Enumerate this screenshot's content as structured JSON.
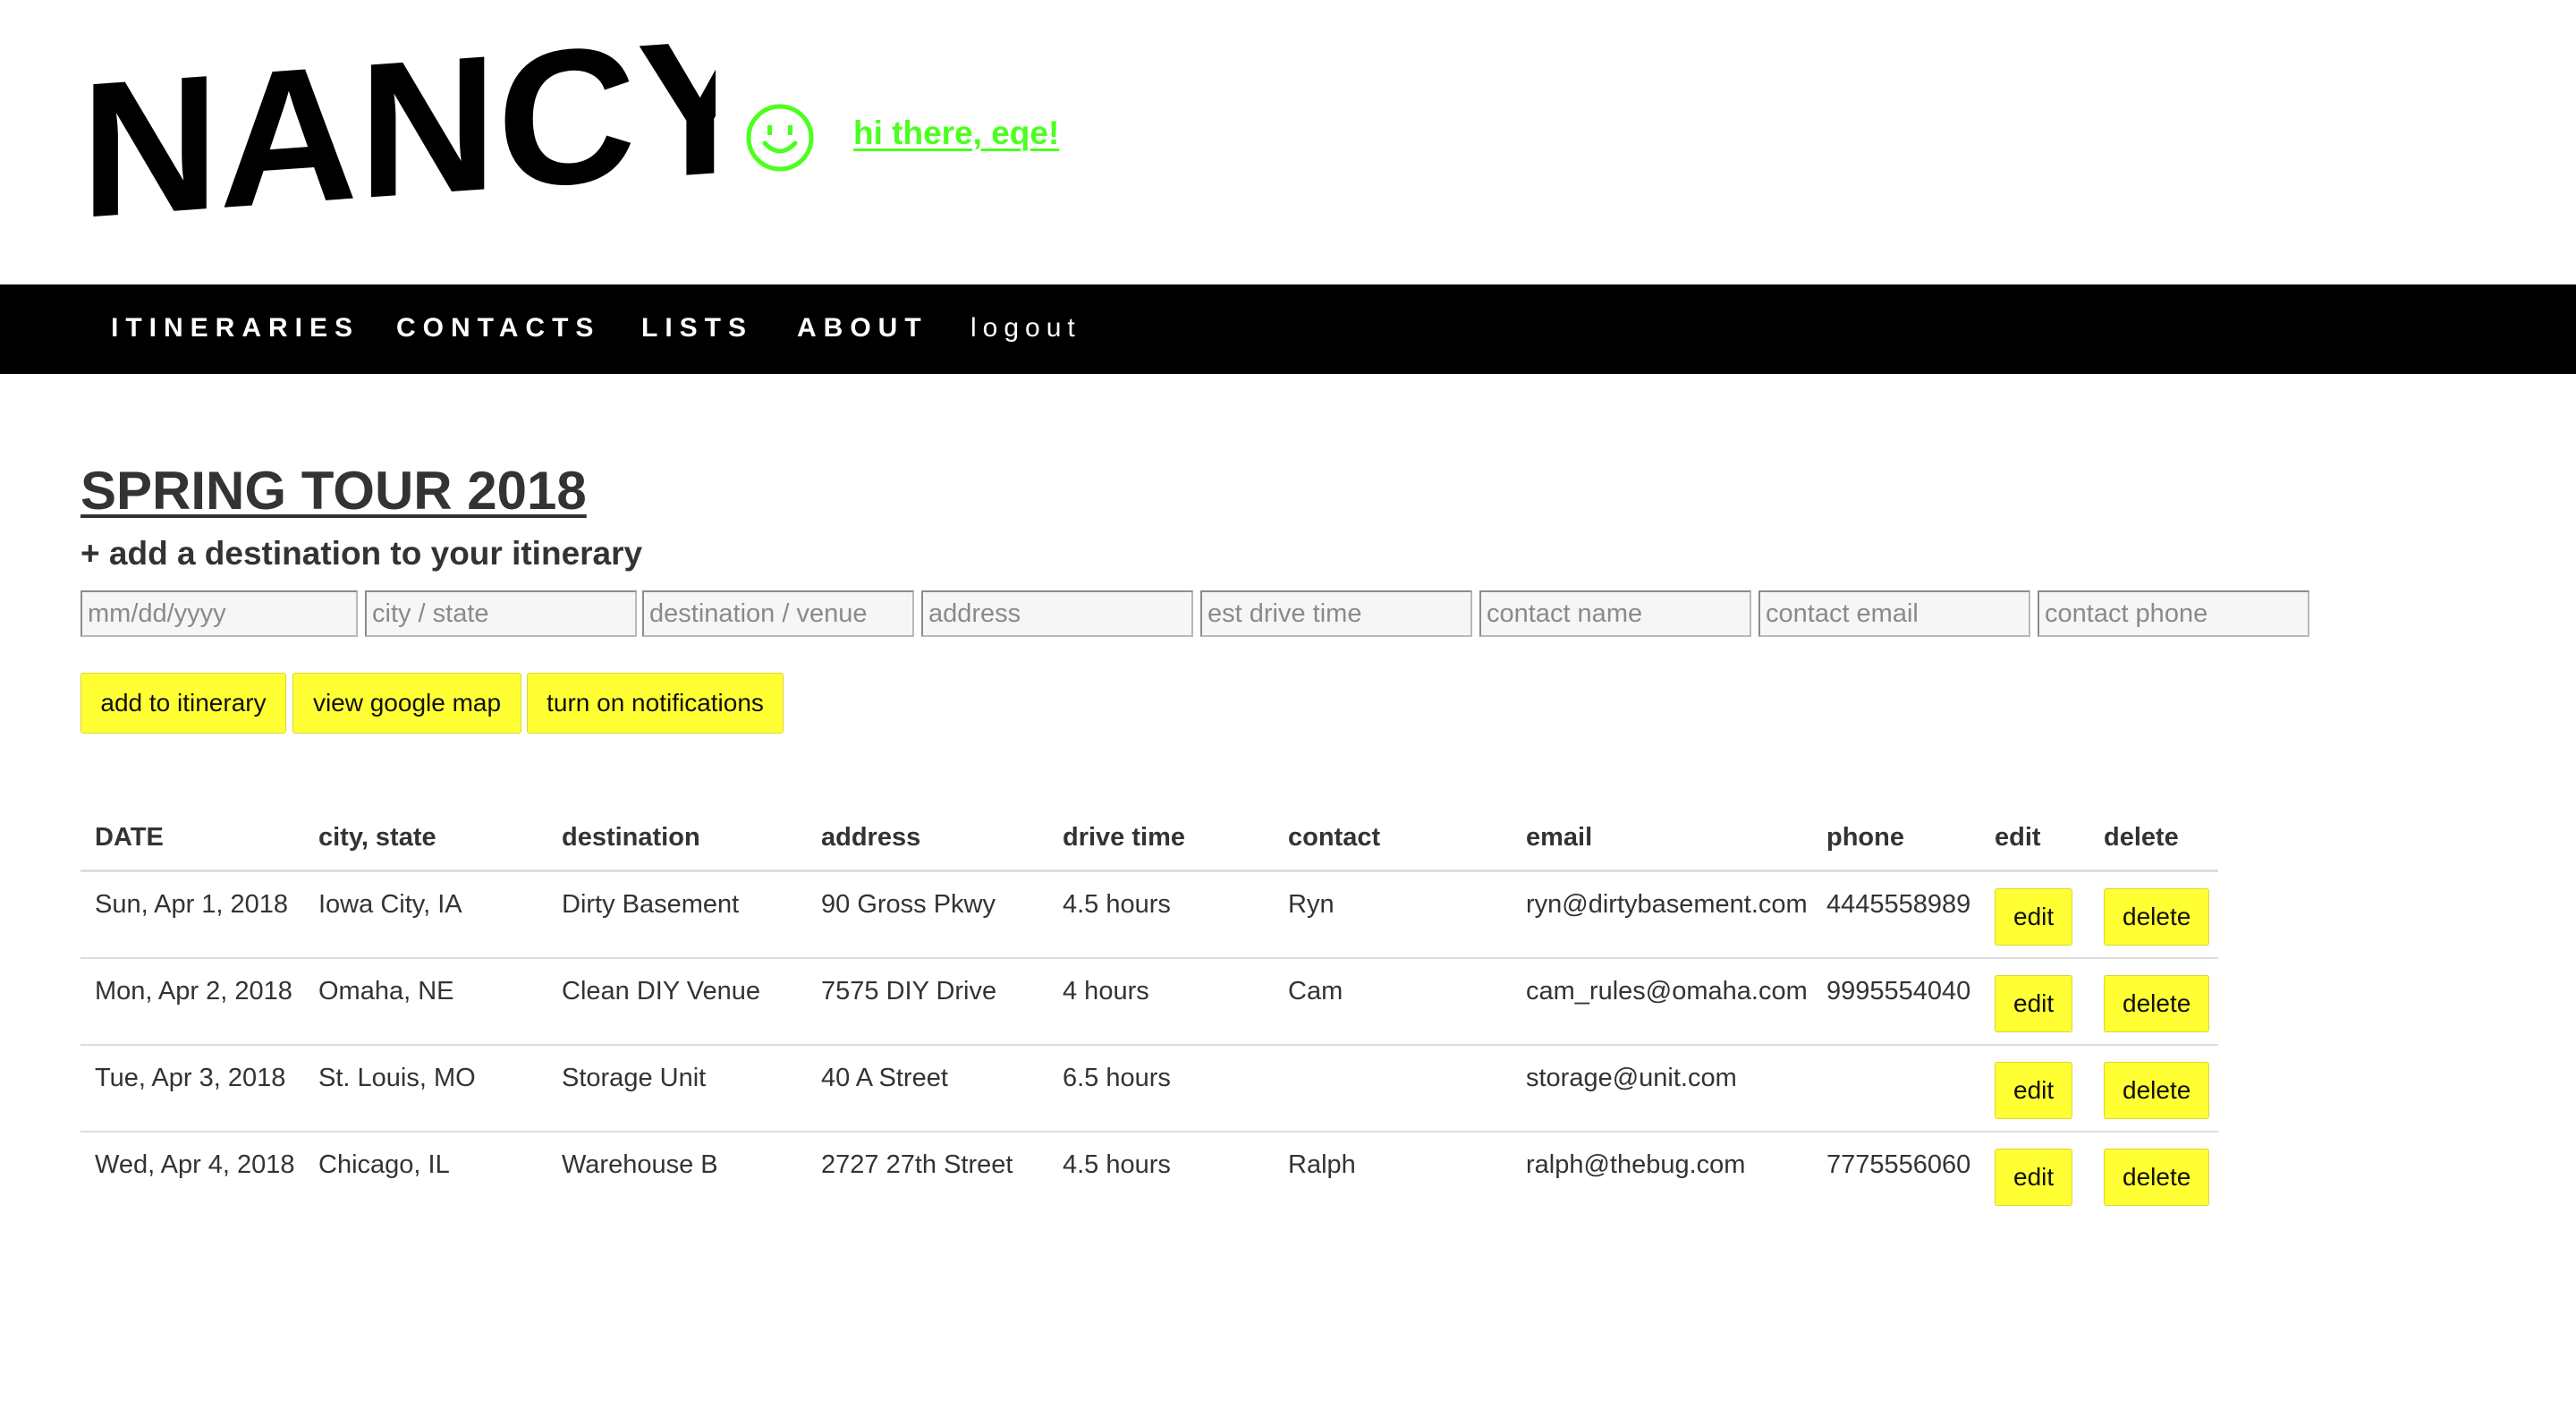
{
  "app": {
    "logo_text": "NANCY",
    "greeting": "hi there, eqe!"
  },
  "nav": {
    "items": [
      {
        "label": "ITINERARIES"
      },
      {
        "label": "CONTACTS"
      },
      {
        "label": "LISTS"
      },
      {
        "label": "ABOUT"
      },
      {
        "label": "logout"
      }
    ]
  },
  "page": {
    "title": "SPRING TOUR 2018",
    "add_heading": "+ add a destination to your itinerary"
  },
  "form": {
    "date_placeholder": "mm/dd/yyyy",
    "city_placeholder": "city / state",
    "destination_placeholder": "destination / venue",
    "address_placeholder": "address",
    "drive_time_placeholder": "est drive time",
    "contact_name_placeholder": "contact name",
    "contact_email_placeholder": "contact email",
    "contact_phone_placeholder": "contact phone"
  },
  "actions": {
    "add_label": "add to itinerary",
    "map_label": "view google map",
    "notify_label": "turn on notifications"
  },
  "table": {
    "headers": {
      "date": "DATE",
      "city": "city, state",
      "destination": "destination",
      "address": "address",
      "drive_time": "drive time",
      "contact": "contact",
      "email": "email",
      "phone": "phone",
      "edit": "edit",
      "delete": "delete"
    },
    "edit_label": "edit",
    "delete_label": "delete",
    "rows": [
      {
        "date": "Sun, Apr 1, 2018",
        "city": "Iowa City, IA",
        "destination": "Dirty Basement",
        "address": "90 Gross Pkwy",
        "drive_time": "4.5 hours",
        "contact": "Ryn",
        "email": "ryn@dirtybasement.com",
        "phone": "4445558989"
      },
      {
        "date": "Mon, Apr 2, 2018",
        "city": "Omaha, NE",
        "destination": "Clean DIY Venue",
        "address": "7575 DIY Drive",
        "drive_time": "4 hours",
        "contact": "Cam",
        "email": "cam_rules@omaha.com",
        "phone": "9995554040"
      },
      {
        "date": "Tue, Apr 3, 2018",
        "city": "St. Louis, MO",
        "destination": "Storage Unit",
        "address": "40 A Street",
        "drive_time": "6.5 hours",
        "contact": "",
        "email": "storage@unit.com",
        "phone": ""
      },
      {
        "date": "Wed, Apr 4, 2018",
        "city": "Chicago, IL",
        "destination": "Warehouse B",
        "address": "2727 27th Street",
        "drive_time": "4.5 hours",
        "contact": "Ralph",
        "email": "ralph@thebug.com",
        "phone": "7775556060"
      }
    ]
  },
  "colors": {
    "accent_yellow": "#ffff33",
    "greeting_green": "#4cff1f",
    "nav_background": "#000000",
    "text": "#333333"
  }
}
